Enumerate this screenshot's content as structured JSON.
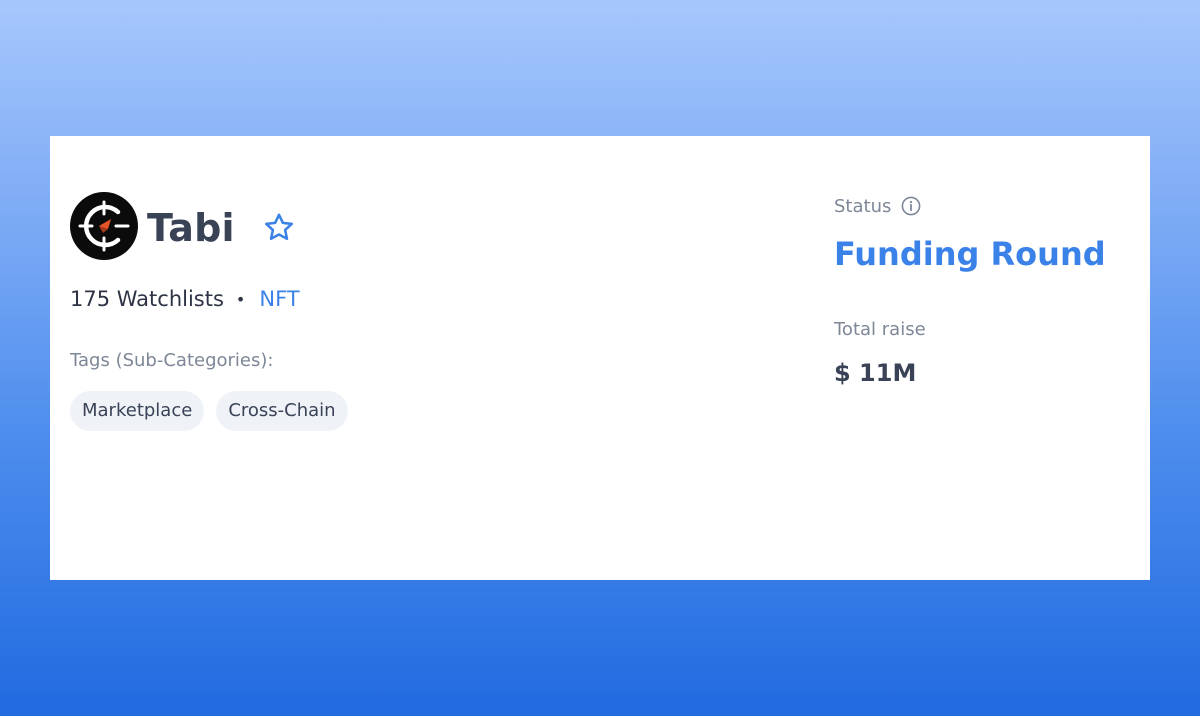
{
  "project": {
    "name": "Tabi",
    "logo_icon": "tabi-compass-logo",
    "watchlist_icon": "star-outline-icon"
  },
  "meta": {
    "watchlists": "175 Watchlists",
    "separator": "•",
    "category": "NFT"
  },
  "tags": {
    "label": "Tags (Sub-Categories):",
    "items": [
      "Marketplace",
      "Cross-Chain"
    ]
  },
  "status": {
    "label": "Status",
    "info_icon": "info-circle-icon",
    "value": "Funding Round"
  },
  "raise": {
    "label": "Total raise",
    "value": "$ 11M"
  },
  "colors": {
    "accent": "#3b82e8",
    "text_dark": "#3a4256",
    "text_muted": "#7d8797",
    "tag_background": "#eff3f8",
    "logo_accent": "#e8542a"
  }
}
